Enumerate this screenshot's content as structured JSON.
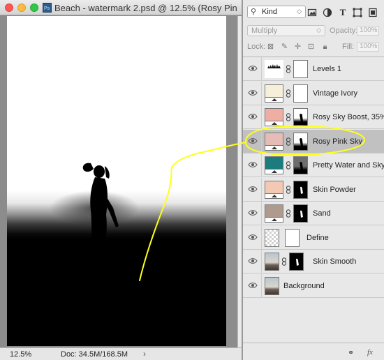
{
  "window": {
    "title": "Beach - watermark 2.psd @ 12.5% (Rosy Pin...",
    "zoom": "12.5%",
    "doc_size": "Doc: 34.5M/168.5M"
  },
  "layers_panel": {
    "filter_kind": "Kind",
    "blend_mode": "Multiply",
    "opacity_label": "Opacity:",
    "opacity_value": "100%",
    "lock_label": "Lock:",
    "fill_label": "Fill:",
    "fill_value": "100%",
    "filter_icons": [
      "image-filter-icon",
      "adjustment-filter-icon",
      "type-filter-icon",
      "shape-filter-icon",
      "smart-object-filter-icon"
    ],
    "layers": [
      {
        "name": "Levels 1",
        "kind": "levels",
        "color": "#ffffff",
        "mask": "white",
        "selected": false
      },
      {
        "name": "Vintage Ivory",
        "kind": "fill",
        "color": "#f6efd9",
        "mask": "white",
        "selected": false
      },
      {
        "name": "Rosy Sky Boost, 35%",
        "kind": "fill",
        "color": "#efaea4",
        "mask": "figure",
        "selected": false
      },
      {
        "name": "Rosy Pink Sky",
        "kind": "fill",
        "color": "#e6bdb6",
        "mask": "figure",
        "selected": true
      },
      {
        "name": "Pretty Water and Sky",
        "kind": "fill",
        "color": "#1b7b7d",
        "mask": "figure-dark",
        "selected": false
      },
      {
        "name": "Skin Powder",
        "kind": "fill",
        "color": "#f4c9b3",
        "mask": "black",
        "selected": false
      },
      {
        "name": "Sand",
        "kind": "fill",
        "color": "#ae9b8e",
        "mask": "black",
        "selected": false
      },
      {
        "name": "Define",
        "kind": "empty",
        "color": "",
        "mask": "white",
        "selected": false
      },
      {
        "name": "Skin Smooth",
        "kind": "photo",
        "color": "",
        "mask": "black",
        "selected": false
      },
      {
        "name": "Background",
        "kind": "photo",
        "color": "",
        "mask": "",
        "selected": false
      }
    ]
  },
  "colors": {
    "annotation": "#ffff1a",
    "selected_row": "#c1c1c1"
  }
}
